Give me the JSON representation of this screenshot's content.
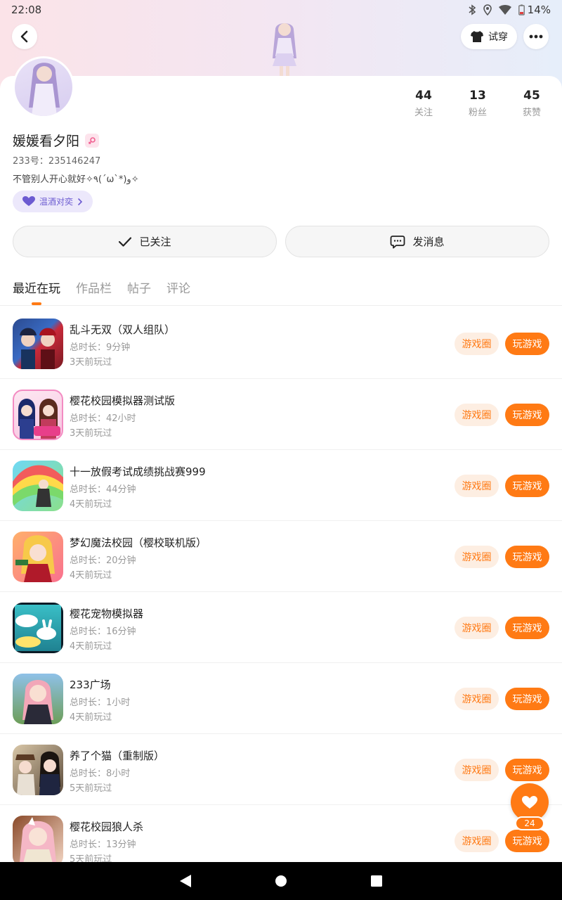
{
  "status_bar": {
    "time": "22:08",
    "battery": "14%"
  },
  "header": {
    "try_on_label": "试穿"
  },
  "profile": {
    "username": "媛媛看夕阳",
    "uid": "233号：235146247",
    "bio": "不管别人开心就好✧٩(ˊωˋ*)و✧",
    "tag_label": "温酒对奕",
    "stats": [
      {
        "value": "44",
        "label": "关注"
      },
      {
        "value": "13",
        "label": "粉丝"
      },
      {
        "value": "45",
        "label": "获赞"
      }
    ],
    "follow_label": "已关注",
    "message_label": "发消息"
  },
  "tabs": [
    {
      "label": "最近在玩",
      "active": true
    },
    {
      "label": "作品栏",
      "active": false
    },
    {
      "label": "帖子",
      "active": false
    },
    {
      "label": "评论",
      "active": false
    }
  ],
  "games": [
    {
      "title": "乱斗无双（双人组队）",
      "duration": "总时长：9分钟",
      "last_played": "3天前玩过",
      "circle_label": "游戏圈",
      "play_label": "玩游戏",
      "icon": "game-icon-brawl"
    },
    {
      "title": "樱花校园模拟器测试版",
      "duration": "总时长：42小时",
      "last_played": "3天前玩过",
      "circle_label": "游戏圈",
      "play_label": "玩游戏",
      "icon": "game-icon-sakura-test"
    },
    {
      "title": "十一放假考试成绩挑战赛999",
      "duration": "总时长：44分钟",
      "last_played": "4天前玩过",
      "circle_label": "游戏圈",
      "play_label": "玩游戏",
      "icon": "game-icon-exam"
    },
    {
      "title": "梦幻魔法校园（樱校联机版）",
      "duration": "总时长：20分钟",
      "last_played": "4天前玩过",
      "circle_label": "游戏圈",
      "play_label": "玩游戏",
      "icon": "game-icon-magic"
    },
    {
      "title": "樱花宠物模拟器",
      "duration": "总时长：16分钟",
      "last_played": "4天前玩过",
      "circle_label": "游戏圈",
      "play_label": "玩游戏",
      "icon": "game-icon-pet"
    },
    {
      "title": "233广场",
      "duration": "总时长：1小时",
      "last_played": "4天前玩过",
      "circle_label": "游戏圈",
      "play_label": "玩游戏",
      "icon": "game-icon-plaza"
    },
    {
      "title": "养了个猫（重制版）",
      "duration": "总时长：8小时",
      "last_played": "5天前玩过",
      "circle_label": "游戏圈",
      "play_label": "玩游戏",
      "icon": "game-icon-cat"
    },
    {
      "title": "樱花校园狼人杀",
      "duration": "总时长：13分钟",
      "last_played": "5天前玩过",
      "circle_label": "游戏圈",
      "play_label": "玩游戏",
      "icon": "game-icon-werewolf"
    }
  ],
  "like_fab": {
    "count": "24"
  },
  "colors": {
    "accent": "#ff7a14",
    "accent_soft": "#fdeee2",
    "tag_bg": "#ece8fb",
    "tag_text": "#6c5bd1"
  }
}
